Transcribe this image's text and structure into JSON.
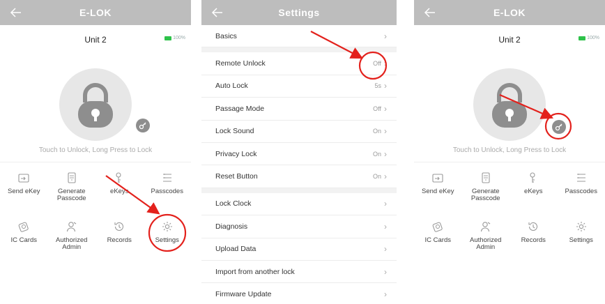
{
  "screen1": {
    "title": "E-LOK",
    "unit": "Unit 2",
    "battery": "100%",
    "hint": "Touch to Unlock, Long Press to Lock",
    "actions": [
      {
        "label": "Send eKey",
        "icon": "send-ekey-icon"
      },
      {
        "label": "Generate Passcode",
        "icon": "generate-passcode-icon"
      },
      {
        "label": "eKeys",
        "icon": "ekeys-icon"
      },
      {
        "label": "Passcodes",
        "icon": "passcodes-icon"
      },
      {
        "label": "IC Cards",
        "icon": "ic-cards-icon"
      },
      {
        "label": "Authorized Admin",
        "icon": "authorized-admin-icon"
      },
      {
        "label": "Records",
        "icon": "records-icon"
      },
      {
        "label": "Settings",
        "icon": "settings-icon"
      }
    ]
  },
  "screen2": {
    "title": "Settings",
    "rows": [
      {
        "label": "Basics",
        "value": ""
      },
      {
        "label": "Remote Unlock",
        "value": "Off"
      },
      {
        "label": "Auto Lock",
        "value": "5s"
      },
      {
        "label": "Passage Mode",
        "value": "Off"
      },
      {
        "label": "Lock Sound",
        "value": "On"
      },
      {
        "label": "Privacy Lock",
        "value": "On"
      },
      {
        "label": "Reset Button",
        "value": "On"
      },
      {
        "label": "Lock Clock",
        "value": ""
      },
      {
        "label": "Diagnosis",
        "value": ""
      },
      {
        "label": "Upload Data",
        "value": ""
      },
      {
        "label": "Import from another lock",
        "value": ""
      },
      {
        "label": "Firmware Update",
        "value": ""
      }
    ]
  },
  "screen3": {
    "title": "E-LOK",
    "unit": "Unit 2",
    "battery": "100%",
    "hint": "Touch to Unlock, Long Press to Lock",
    "actions": [
      {
        "label": "Send eKey",
        "icon": "send-ekey-icon"
      },
      {
        "label": "Generate Passcode",
        "icon": "generate-passcode-icon"
      },
      {
        "label": "eKeys",
        "icon": "ekeys-icon"
      },
      {
        "label": "Passcodes",
        "icon": "passcodes-icon"
      },
      {
        "label": "IC Cards",
        "icon": "ic-cards-icon"
      },
      {
        "label": "Authorized Admin",
        "icon": "authorized-admin-icon"
      },
      {
        "label": "Records",
        "icon": "records-icon"
      },
      {
        "label": "Settings",
        "icon": "settings-icon"
      }
    ]
  },
  "colors": {
    "topbar": "#bdbdbd",
    "annotation": "#e3211c",
    "battery": "#2ec24a"
  }
}
